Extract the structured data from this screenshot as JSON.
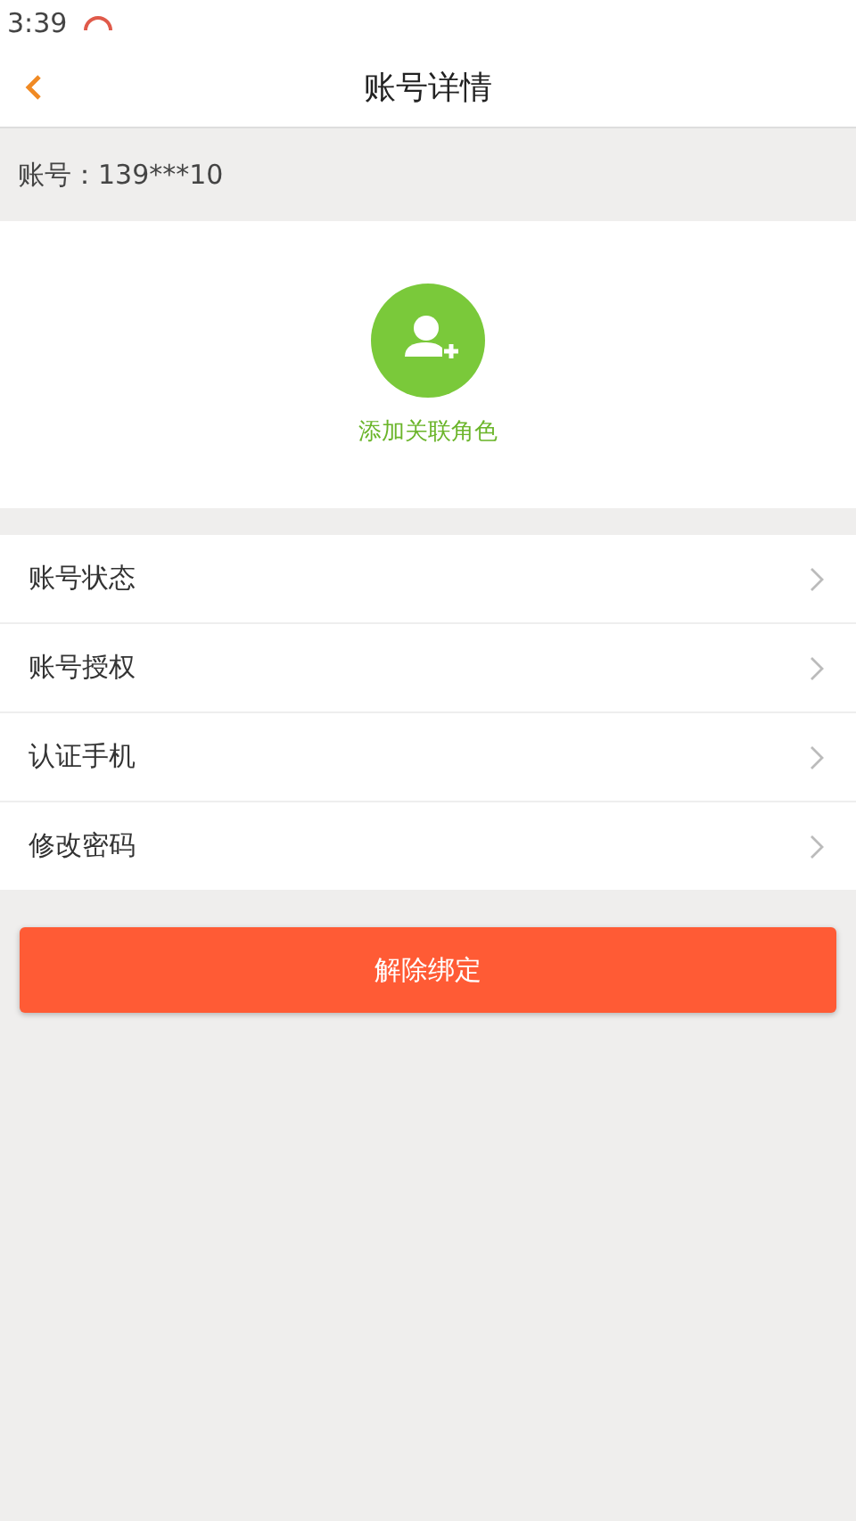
{
  "status_bar": {
    "time": "3:39"
  },
  "header": {
    "title": "账号详情"
  },
  "account": {
    "label": "账号：139***10"
  },
  "add_role": {
    "label": "添加关联角色"
  },
  "menu": [
    {
      "label": "账号状态"
    },
    {
      "label": "账号授权"
    },
    {
      "label": "认证手机"
    },
    {
      "label": "修改密码"
    }
  ],
  "unbind_button": {
    "label": "解除绑定"
  }
}
